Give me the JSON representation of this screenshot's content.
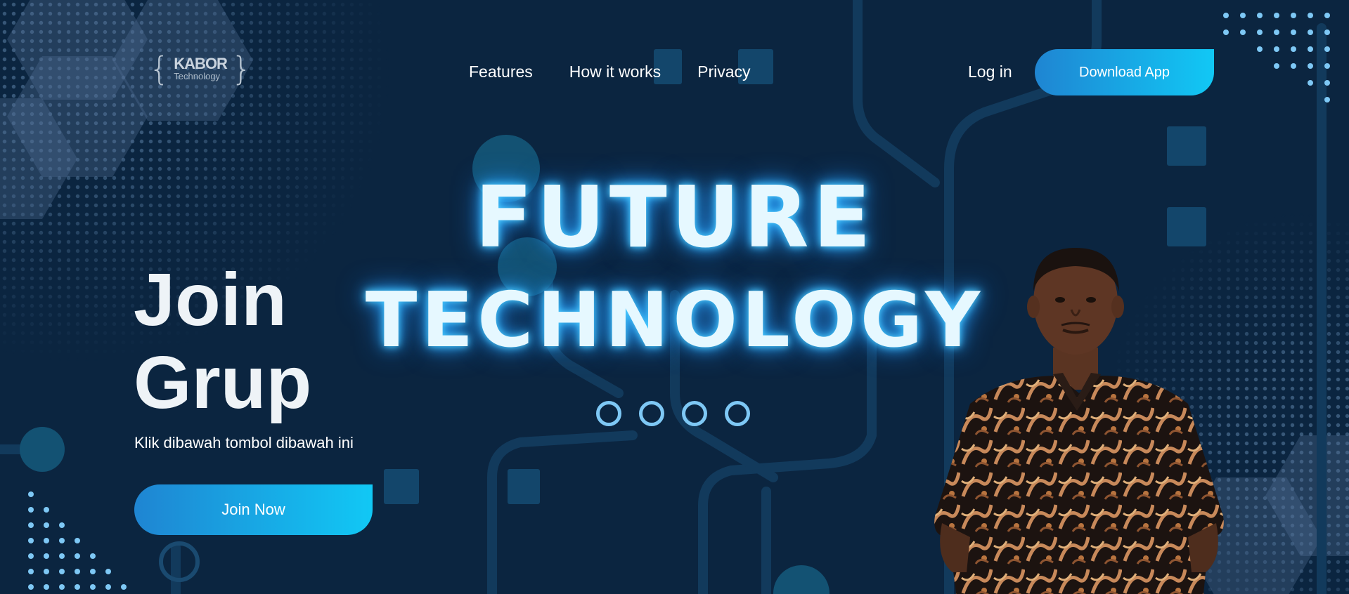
{
  "brand": {
    "name": "KABOR",
    "tagline": "Technology"
  },
  "nav": {
    "items": [
      "Features",
      "How it works",
      "Privacy"
    ]
  },
  "header": {
    "login_label": "Log in",
    "download_label": "Download App"
  },
  "hero": {
    "headline_line1": "FUTURE",
    "headline_line2": "TECHNOLOGY",
    "slide_count": 4
  },
  "cta": {
    "title_line1": "Join",
    "title_line2": "Grup",
    "subtitle": "Klik dibawah tombol dibawah ini",
    "button_label": "Join Now"
  },
  "colors": {
    "background": "#0b2540",
    "accent_start": "#1f85d2",
    "accent_end": "#11c8f5",
    "glow": "#4fd0ff",
    "dot": "#7ec8f5"
  }
}
